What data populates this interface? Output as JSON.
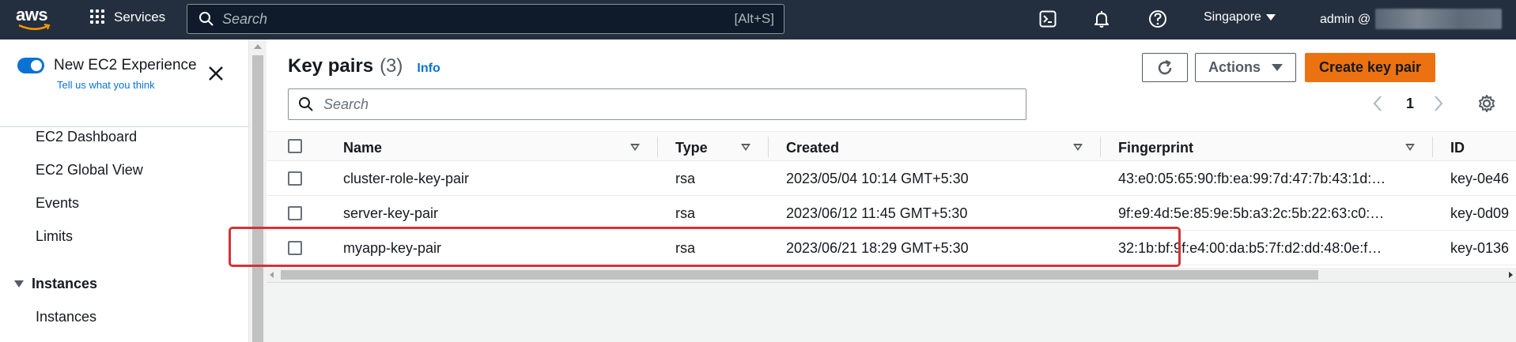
{
  "topnav": {
    "logo_text": "aws",
    "services_label": "Services",
    "search_placeholder": "Search",
    "search_shortcut": "[Alt+S]",
    "region": "Singapore",
    "user": "admin @"
  },
  "sidebar": {
    "toggle_label": "New EC2 Experience",
    "feedback_link": "Tell us what you think",
    "items": [
      {
        "label": "EC2 Dashboard"
      },
      {
        "label": "EC2 Global View"
      },
      {
        "label": "Events"
      },
      {
        "label": "Limits"
      }
    ],
    "section": {
      "label": "Instances",
      "items": [
        {
          "label": "Instances"
        }
      ]
    }
  },
  "main": {
    "title": "Key pairs",
    "count": "(3)",
    "info_link": "Info",
    "actions_label": "Actions",
    "create_label": "Create key pair",
    "search_placeholder": "Search",
    "page": "1",
    "columns": [
      "Name",
      "Type",
      "Created",
      "Fingerprint",
      "ID"
    ],
    "rows": [
      {
        "name": "cluster-role-key-pair",
        "type": "rsa",
        "created": "2023/05/04 10:14 GMT+5:30",
        "fingerprint": "43:e0:05:65:90:fb:ea:99:7d:47:7b:43:1d:…",
        "id": "key-0e46"
      },
      {
        "name": "server-key-pair",
        "type": "rsa",
        "created": "2023/06/12 11:45 GMT+5:30",
        "fingerprint": "9f:e9:4d:5e:85:9e:5b:a3:2c:5b:22:63:c0:…",
        "id": "key-0d09"
      },
      {
        "name": "myapp-key-pair",
        "type": "rsa",
        "created": "2023/06/21 18:29 GMT+5:30",
        "fingerprint": "32:1b:bf:9f:e4:00:da:b5:7f:d2:dd:48:0e:f…",
        "id": "key-0136"
      }
    ],
    "highlighted_row": "myapp-key-pair"
  },
  "colors": {
    "nav_bg": "#232f3e",
    "accent_blue": "#0972d3",
    "primary_orange": "#ec7211",
    "highlight_red": "#d13438"
  }
}
